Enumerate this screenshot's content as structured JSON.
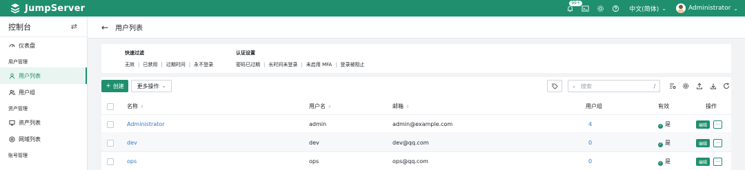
{
  "topbar": {
    "brand": "JumpServer",
    "notification_count": "99+",
    "language": "中文(简体)",
    "user_name": "Administrator",
    "icons": [
      "bell-icon",
      "terminal-icon",
      "settings-icon",
      "help-icon"
    ]
  },
  "sidebar": {
    "title": "控制台",
    "items": [
      {
        "type": "item",
        "label": "仪表盘",
        "icon": "dashboard-icon"
      },
      {
        "type": "group",
        "label": "用户管理"
      },
      {
        "type": "item",
        "label": "用户列表",
        "icon": "user-icon",
        "active": true
      },
      {
        "type": "item",
        "label": "用户组",
        "icon": "users-icon"
      },
      {
        "type": "group",
        "label": "资产管理"
      },
      {
        "type": "item",
        "label": "资产列表",
        "icon": "monitor-icon"
      },
      {
        "type": "item",
        "label": "网域列表",
        "icon": "globe-icon"
      },
      {
        "type": "group",
        "label": "账号管理"
      }
    ]
  },
  "page": {
    "title": "用户列表"
  },
  "filters": {
    "quick": {
      "heading": "快速过滤",
      "options": [
        "无效",
        "已禁用",
        "过期时间",
        "永不登录"
      ]
    },
    "auth": {
      "heading": "认证设置",
      "options": [
        "密码已过期",
        "长时间未登录",
        "未启用 MFA",
        "登录被阻止"
      ]
    }
  },
  "toolbar": {
    "create_label": "创建",
    "more_label": "更多操作",
    "search_placeholder": "搜索",
    "search_slash": "/"
  },
  "table": {
    "columns": {
      "name": "名称",
      "username": "用户名",
      "email": "邮箱",
      "groups": "用户组",
      "active": "有效",
      "actions": "操作"
    },
    "rows": [
      {
        "name": "Administrator",
        "username": "admin",
        "email": "admin@example.com",
        "groups": "4",
        "active": "是"
      },
      {
        "name": "dev",
        "username": "dev",
        "email": "dev@qq.com",
        "groups": "0",
        "active": "是"
      },
      {
        "name": "ops",
        "username": "ops",
        "email": "ops@qq.com",
        "groups": "0",
        "active": "是"
      }
    ],
    "edit_label": "编辑",
    "more_dots": "···"
  },
  "colors": {
    "brand": "#1f8f6e",
    "link": "#2f7ac4"
  }
}
